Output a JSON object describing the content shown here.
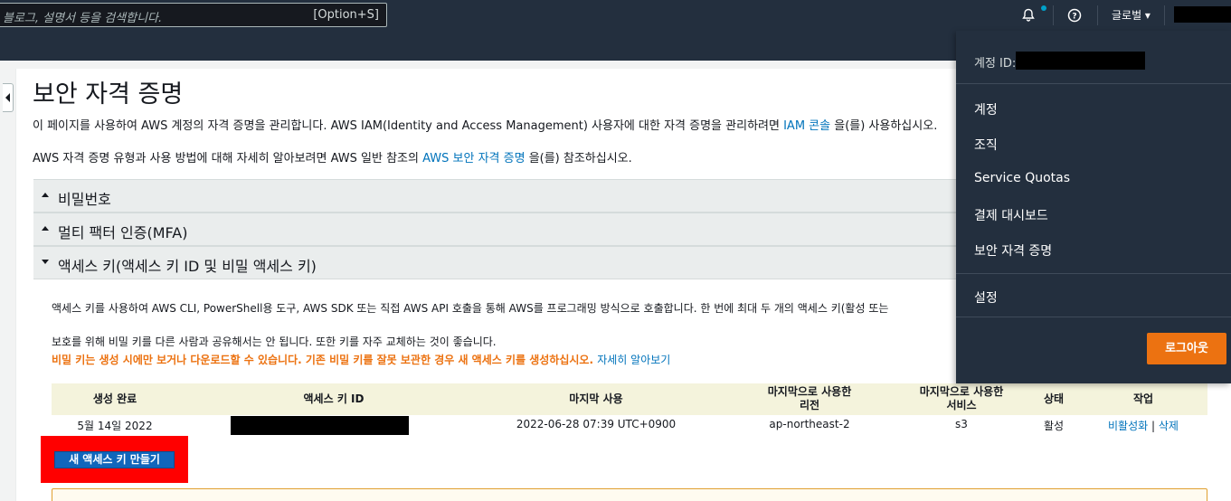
{
  "topnav": {
    "search_placeholder": "블로그, 설명서 등을 검색합니다.",
    "search_shortcut": "[Option+S]",
    "region_label": "글로벌 ▾",
    "help_icon": "?"
  },
  "page": {
    "title": "보안 자격 증명",
    "intro_text": "이 페이지를 사용하여 AWS 계정의 자격 증명을 관리합니다. AWS IAM(Identity and Access Management) 사용자에 대한 자격 증명을 관리하려면",
    "intro_link": "IAM 콘솔",
    "intro_tail": "을(를) 사용하십시오.",
    "info_text": "AWS 자격 증명 유형과 사용 방법에 대해 자세히 알아보려면 AWS 일반 참조의",
    "info_link": "AWS 보안 자격 증명",
    "info_tail": "을(를) 참조하십시오."
  },
  "accordion": [
    {
      "label": "비밀번호"
    },
    {
      "label": "멀티 팩터 인증(MFA)"
    },
    {
      "label": "액세스 키(액세스 키 ID 및 비밀 액세스 키)"
    }
  ],
  "access_keys": {
    "desc": "액세스 키를 사용하여 AWS CLI, PowerShell용 도구, AWS SDK 또는 직접 AWS API 호출을 통해 AWS를 프로그래밍 방식으로 호출합니다. 한 번에 최대 두 개의 액세스 키(활성 또는",
    "protect_text": "보호를 위해 비밀 키를 다른 사람과 공유해서는 안 됩니다. 또한 키를 자주 교체하는 것이 좋습니다.",
    "warning_text": "비밀 키는 생성 시에만 보거나 다운로드할 수 있습니다. 기존 비밀 키를 잘못 보관한 경우 새 액세스 키를 생성하십시오.",
    "learn_more": "자세히 알아보기",
    "columns": [
      "생성 완료",
      "액세스 키 ID",
      "마지막 사용",
      "마지막으로 사용한\n리전",
      "마지막으로 사용한\n서비스",
      "상태",
      "작업"
    ],
    "row": {
      "created": "5월 14일 2022",
      "last_used": "2022-06-28 07:39 UTC+0900",
      "region": "ap-northeast-2",
      "service": "s3",
      "status": "활성",
      "action_deactivate": "비활성화",
      "action_sep": "|",
      "action_delete": "삭제"
    },
    "create_button": "새 액세스 키 만들기"
  },
  "dropdown": {
    "account_id_label": "계정 ID:",
    "items": [
      "계정",
      "조직",
      "Service Quotas",
      "결제 대시보드",
      "보안 자격 증명"
    ],
    "settings": "설정",
    "logout": "로그아웃"
  }
}
